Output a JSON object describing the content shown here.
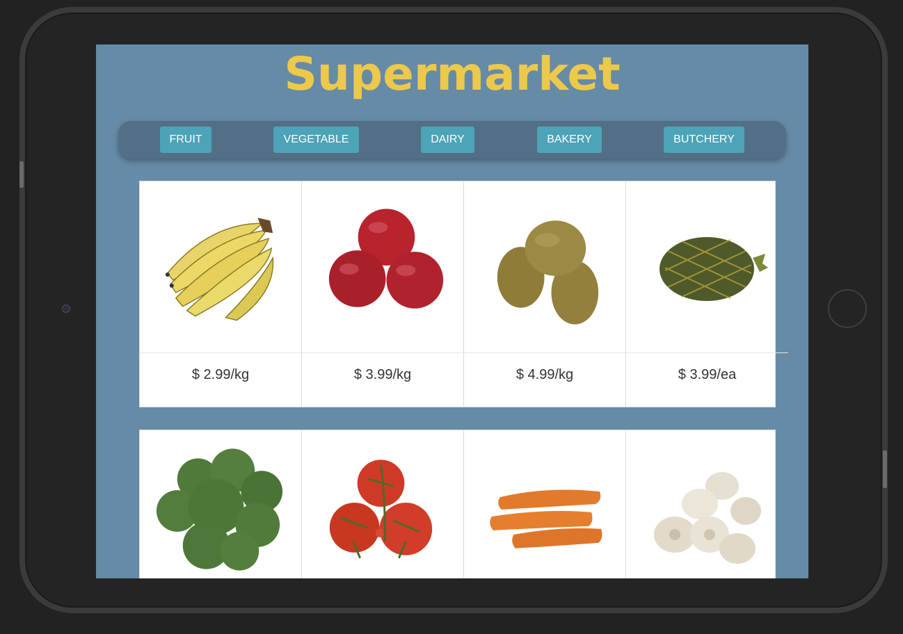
{
  "app": {
    "title": "Supermarket"
  },
  "nav": {
    "items": [
      {
        "label": "FRUIT"
      },
      {
        "label": "VEGETABLE"
      },
      {
        "label": "DAIRY"
      },
      {
        "label": "BAKERY"
      },
      {
        "label": "BUTCHERY"
      }
    ]
  },
  "products": {
    "fruit": [
      {
        "icon": "banana-icon",
        "price": "$ 2.99/kg"
      },
      {
        "icon": "apple-icon",
        "price": "$ 3.99/kg"
      },
      {
        "icon": "kiwi-icon",
        "price": "$ 4.99/kg"
      },
      {
        "icon": "pineapple-icon",
        "price": "$ 3.99/ea"
      }
    ],
    "vegetable": [
      {
        "icon": "broccoli-icon"
      },
      {
        "icon": "tomato-icon"
      },
      {
        "icon": "carrot-icon"
      },
      {
        "icon": "mushroom-icon"
      }
    ]
  },
  "colors": {
    "background": "#668ba7",
    "title": "#ecc94b",
    "nav_bar": "#536f85",
    "nav_button": "#4da3b7"
  }
}
